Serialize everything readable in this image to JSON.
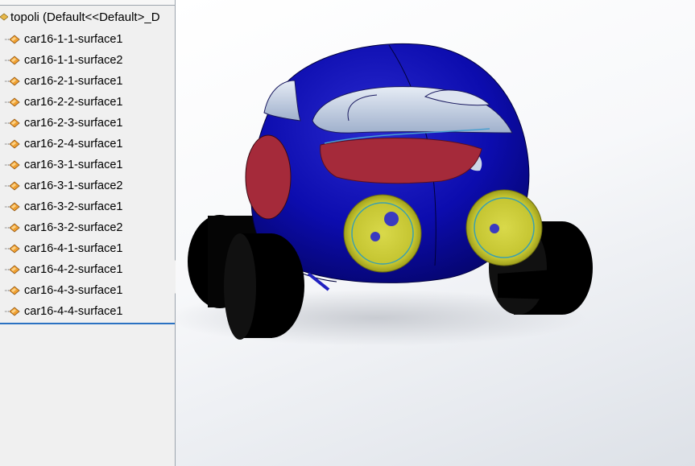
{
  "tree": {
    "root_label": "topoli  (Default<<Default>_D",
    "items": [
      {
        "label": "car16-1-1-surface1"
      },
      {
        "label": "car16-1-1-surface2"
      },
      {
        "label": "car16-2-1-surface1"
      },
      {
        "label": "car16-2-2-surface1"
      },
      {
        "label": "car16-2-3-surface1"
      },
      {
        "label": "car16-2-4-surface1"
      },
      {
        "label": "car16-3-1-surface1"
      },
      {
        "label": "car16-3-1-surface2"
      },
      {
        "label": "car16-3-2-surface1"
      },
      {
        "label": "car16-3-2-surface2"
      },
      {
        "label": "car16-4-1-surface1"
      },
      {
        "label": "car16-4-2-surface1"
      },
      {
        "label": "car16-4-3-surface1"
      },
      {
        "label": "car16-4-4-surface1"
      }
    ],
    "item_icon": "surface-body-icon",
    "root_icon": "part-icon"
  },
  "colors": {
    "body": "#0a0aa8",
    "window": "#c9d4e6",
    "interior": "#a52a3a",
    "headlight": "#c8c83a",
    "tire": "#000000",
    "icon_orange": "#f0a030"
  },
  "viewport": {
    "model": "car-3d-model"
  }
}
